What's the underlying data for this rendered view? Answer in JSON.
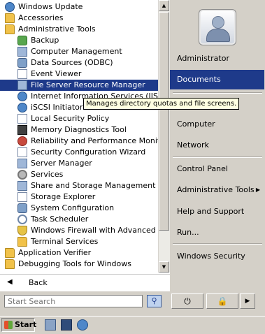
{
  "programs": [
    {
      "label": "Windows Update",
      "icon": "windows-update-icon",
      "kind": "globe",
      "depth": 0
    },
    {
      "label": "Accessories",
      "icon": "folder-icon",
      "kind": "folder",
      "depth": 0
    },
    {
      "label": "Administrative Tools",
      "icon": "folder-icon",
      "kind": "folder",
      "depth": 0
    },
    {
      "label": "Backup",
      "icon": "backup-icon",
      "kind": "green",
      "depth": 1
    },
    {
      "label": "Computer Management",
      "icon": "computer-management-icon",
      "kind": "tool",
      "depth": 1
    },
    {
      "label": "Data Sources (ODBC)",
      "icon": "odbc-icon",
      "kind": "tool2",
      "depth": 1
    },
    {
      "label": "Event Viewer",
      "icon": "event-viewer-icon",
      "kind": "doc",
      "depth": 1
    },
    {
      "label": "File Server Resource Manager",
      "icon": "fsrm-icon",
      "kind": "tool",
      "depth": 1,
      "selected": true
    },
    {
      "label": "Internet Information Services (IIS) Manager",
      "icon": "iis-icon",
      "kind": "globe",
      "depth": 1
    },
    {
      "label": "iSCSI Initiator",
      "icon": "iscsi-icon",
      "kind": "globe",
      "depth": 1
    },
    {
      "label": "Local Security Policy",
      "icon": "security-policy-icon",
      "kind": "doc",
      "depth": 1
    },
    {
      "label": "Memory Diagnostics Tool",
      "icon": "memory-icon",
      "kind": "mem",
      "depth": 1
    },
    {
      "label": "Reliability and Performance Monitor",
      "icon": "performance-icon",
      "kind": "red",
      "depth": 1
    },
    {
      "label": "Security Configuration Wizard",
      "icon": "wizard-icon",
      "kind": "doc",
      "depth": 1
    },
    {
      "label": "Server Manager",
      "icon": "server-manager-icon",
      "kind": "tool",
      "depth": 1
    },
    {
      "label": "Services",
      "icon": "services-icon",
      "kind": "gear",
      "depth": 1
    },
    {
      "label": "Share and Storage Management",
      "icon": "share-icon",
      "kind": "tool",
      "depth": 1
    },
    {
      "label": "Storage Explorer",
      "icon": "storage-icon",
      "kind": "doc",
      "depth": 1
    },
    {
      "label": "System Configuration",
      "icon": "system-config-icon",
      "kind": "tool2",
      "depth": 1
    },
    {
      "label": "Task Scheduler",
      "icon": "task-scheduler-icon",
      "kind": "clock",
      "depth": 1
    },
    {
      "label": "Windows Firewall with Advanced Security",
      "icon": "firewall-icon",
      "kind": "shield",
      "depth": 1
    },
    {
      "label": "Terminal Services",
      "icon": "folder-icon",
      "kind": "folder",
      "depth": 1
    },
    {
      "label": "Application Verifier",
      "icon": "folder-icon",
      "kind": "folder",
      "depth": 0
    },
    {
      "label": "Debugging Tools for Windows",
      "icon": "folder-icon",
      "kind": "folder",
      "depth": 0
    }
  ],
  "back_label": "Back",
  "tooltip": "Manages directory quotas and file screens.",
  "right_items": [
    {
      "label": "Administrator",
      "selected": false,
      "arrow": false
    },
    {
      "label": "Documents",
      "selected": true,
      "arrow": false
    },
    {
      "label": "Computer",
      "selected": false,
      "arrow": false
    },
    {
      "label": "Network",
      "selected": false,
      "arrow": false
    },
    {
      "label": "Control Panel",
      "selected": false,
      "arrow": false
    },
    {
      "label": "Administrative Tools",
      "selected": false,
      "arrow": true
    },
    {
      "label": "Help and Support",
      "selected": false,
      "arrow": false
    },
    {
      "label": "Run...",
      "selected": false,
      "arrow": false
    },
    {
      "label": "Windows Security",
      "selected": false,
      "arrow": false
    }
  ],
  "search": {
    "placeholder": "Start Search"
  },
  "taskbar": {
    "start_label": "Start"
  },
  "colors": {
    "selection": "#1e3a8a",
    "panel": "#d4d0c8"
  }
}
